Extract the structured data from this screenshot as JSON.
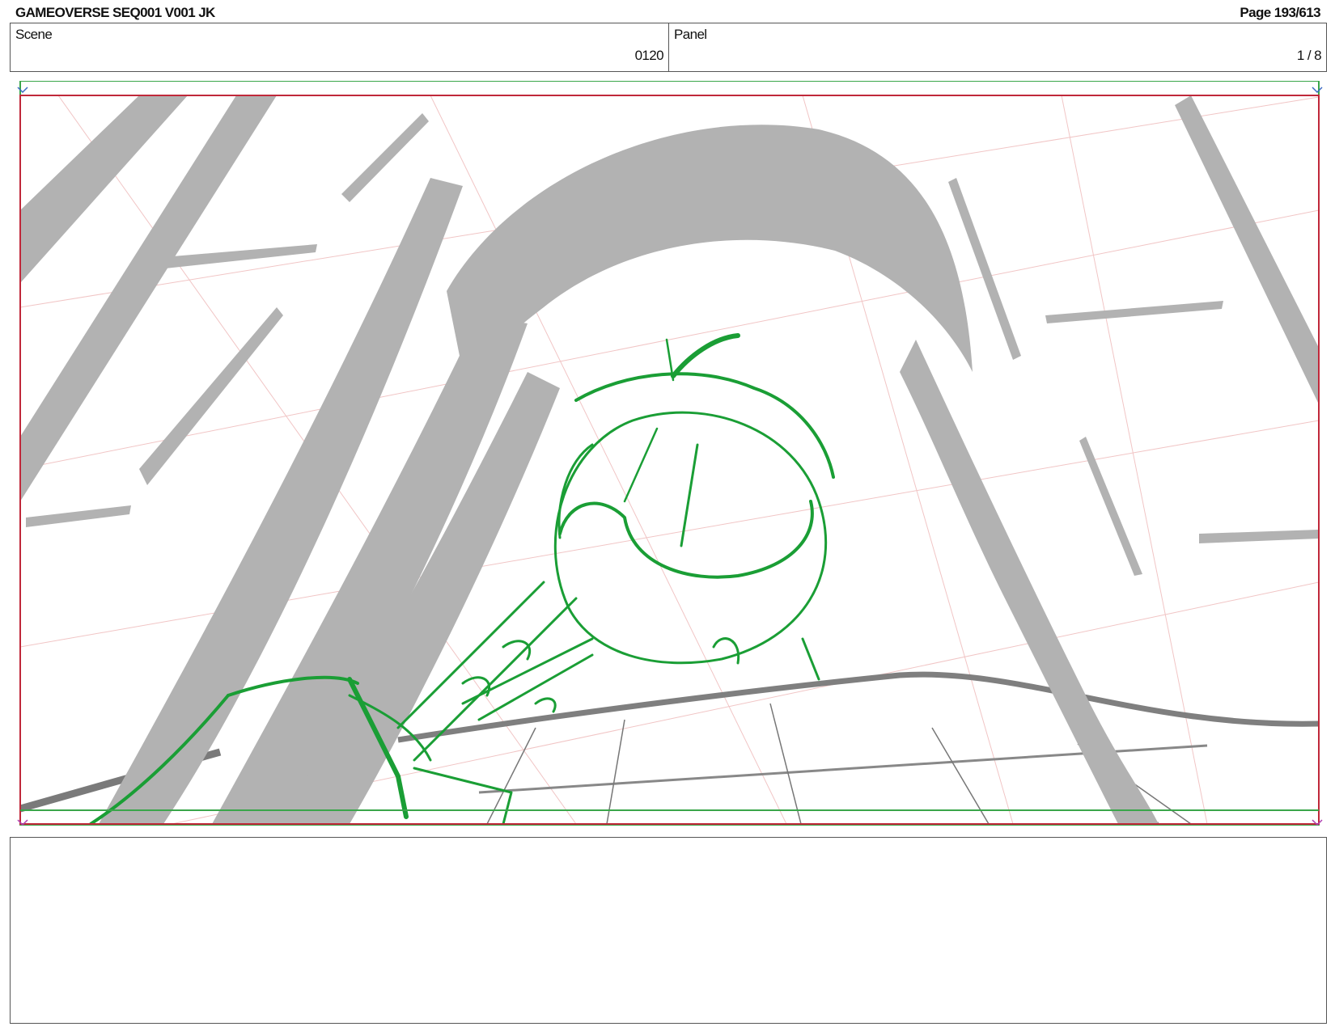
{
  "header": {
    "title": "GAMEOVERSE SEQ001 V001 JK",
    "page": "Page 193/613"
  },
  "info": {
    "scene_label": "Scene",
    "scene_value": "0120",
    "panel_label": "Panel",
    "panel_value": "1 / 8"
  },
  "notes": {
    "text": ""
  },
  "colors": {
    "sketch_green": "#1a9e35",
    "sketch_gray": "#b2b2b2",
    "safe_frame_red": "#c0283a",
    "action_frame_green": "#3aa64a"
  }
}
